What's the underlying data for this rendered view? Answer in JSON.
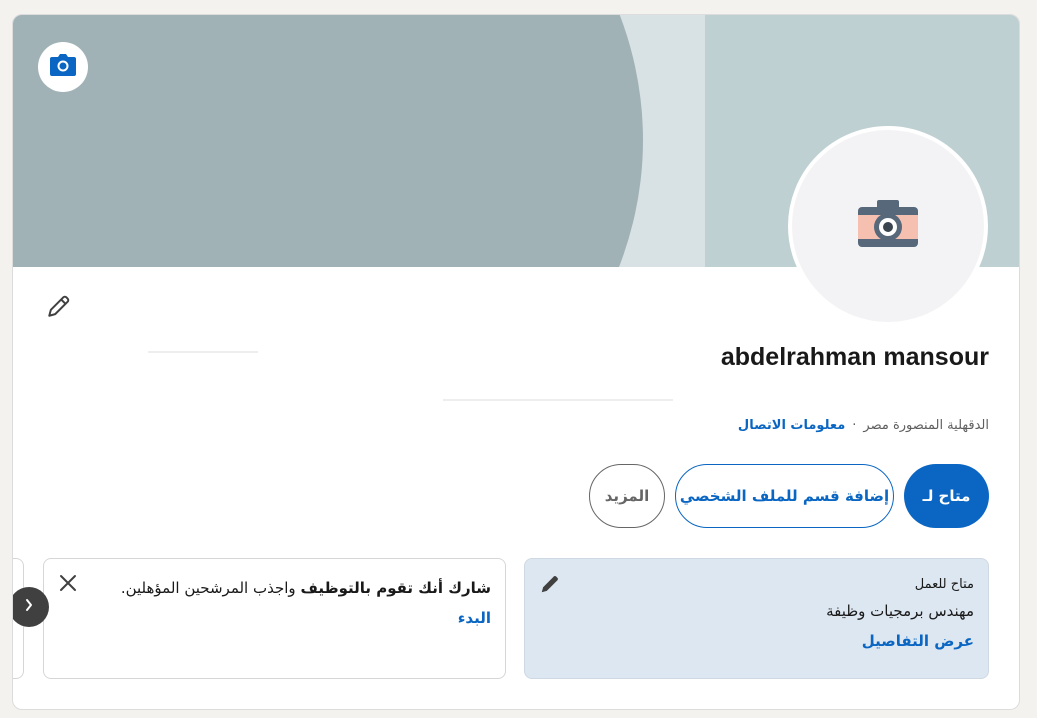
{
  "profile": {
    "name": "abdelrahman mansour",
    "location": "الدقهلية المنصورة مصر",
    "separator": "·",
    "contact_link": "معلومات الاتصال"
  },
  "buttons": {
    "open_to": "متاح لـ",
    "add_section": "إضافة قسم للملف الشخصي",
    "more": "المزيد"
  },
  "open_to_work": {
    "title": "متاح للعمل",
    "role": "مهندس برمجيات وظيفة",
    "details_link": "عرض التفاصيل"
  },
  "hiring": {
    "message_bold": "شارك أنك تقوم بالتوظيف",
    "message_rest": " واجذب المرشحين المؤهلين.",
    "start_link": "البدء"
  },
  "colors": {
    "primary": "#0a66c2",
    "cover_dark": "#a0b2b6",
    "cover_light": "#d8e2e4",
    "cover_band": "#bfd0d3",
    "panel_blue": "#dde7f1"
  },
  "icons": {
    "cover_camera": "camera-icon",
    "avatar_camera": "camera-illustration-icon",
    "edit": "pencil-icon",
    "close": "close-icon",
    "carousel_prev": "chevron-left-icon"
  }
}
